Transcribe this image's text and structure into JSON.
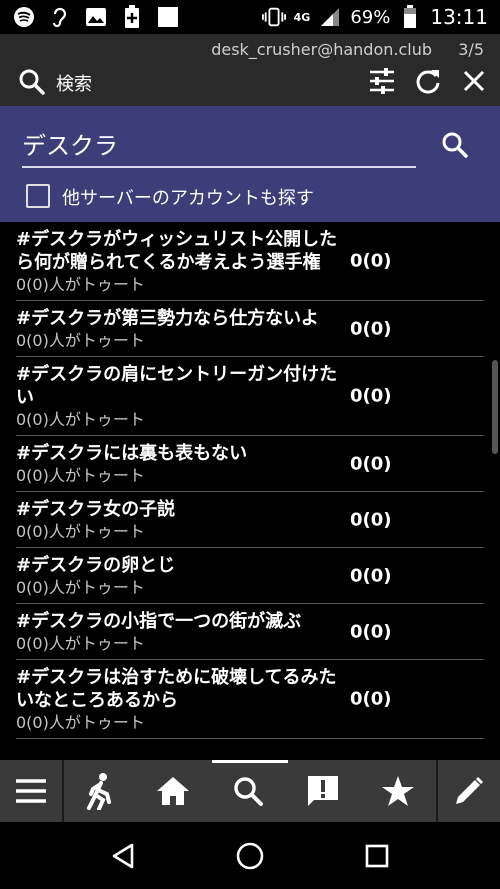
{
  "status_bar": {
    "icons_left": [
      "spotify-icon",
      "hearing-icon",
      "image-icon",
      "battery-saver-icon",
      "notification-icon"
    ],
    "network": "4G",
    "battery": "69%",
    "time": "13:11"
  },
  "header": {
    "account": "desk_crusher@handon.club",
    "pager": "3/5",
    "title": "検索"
  },
  "search": {
    "query": "デスクラ",
    "checkbox_label": "他サーバーのアカウントも探す"
  },
  "results": [
    {
      "title": "#デスクラがウィッシュリスト公開したら何が贈られてくるか考えよう選手権",
      "sub": "0(0)人がトゥート",
      "count": "0(0)"
    },
    {
      "title": "#デスクラが第三勢力なら仕方ないよ",
      "sub": "0(0)人がトゥート",
      "count": "0(0)"
    },
    {
      "title": "#デスクラの肩にセントリーガン付けたい",
      "sub": "0(0)人がトゥート",
      "count": "0(0)"
    },
    {
      "title": "#デスクラには裏も表もない",
      "sub": "0(0)人がトゥート",
      "count": "0(0)"
    },
    {
      "title": "#デスクラ女の子説",
      "sub": "0(0)人がトゥート",
      "count": "0(0)"
    },
    {
      "title": "#デスクラの卵とじ",
      "sub": "0(0)人がトゥート",
      "count": "0(0)"
    },
    {
      "title": "#デスクラの小指で一つの街が滅ぶ",
      "sub": "0(0)人がトゥート",
      "count": "0(0)"
    },
    {
      "title": "#デスクラは治すために破壊してるみたいなところあるから",
      "sub": "0(0)人がトゥート",
      "count": "0(0)"
    }
  ],
  "toolbar": {
    "buttons": [
      "menu-icon",
      "walk-icon",
      "home-icon",
      "search-icon",
      "notification-alert-icon",
      "star-icon",
      "edit-icon"
    ],
    "active": "search-icon"
  },
  "colors": {
    "header_bg": "#2a2a2a",
    "search_panel_bg": "#3d3d7a",
    "toolbar_bg": "#3a3a3a",
    "list_bg": "#000000"
  }
}
